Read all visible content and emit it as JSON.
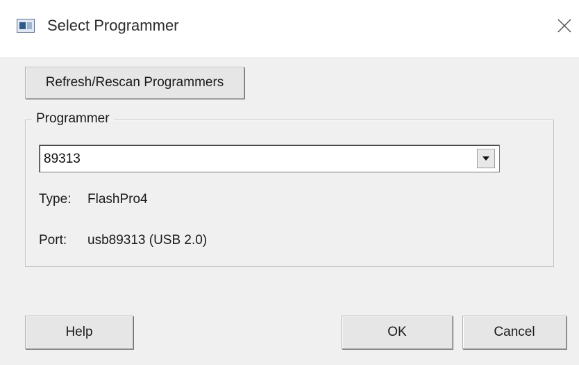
{
  "window": {
    "title": "Select Programmer",
    "icon": "app-window-icon",
    "close_icon": "close-icon"
  },
  "toolbar": {
    "refresh_label": "Refresh/Rescan Programmers"
  },
  "programmer_group": {
    "legend": "Programmer",
    "selected_programmer": "89313",
    "type_label": "Type:",
    "type_value": "FlashPro4",
    "port_label": "Port:",
    "port_value": "usb89313 (USB 2.0)"
  },
  "footer": {
    "help_label": "Help",
    "ok_label": "OK",
    "cancel_label": "Cancel"
  }
}
